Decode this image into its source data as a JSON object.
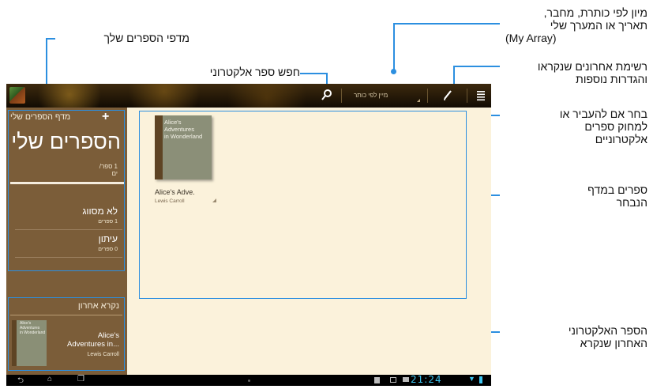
{
  "colors": {
    "accent": "#2c8fe0",
    "clock": "#3dc6f2",
    "sidebar": "#7b5d39",
    "main": "#fbf2db"
  },
  "callouts": {
    "sort_info": [
      "מיון לפי כותרת, מחבר,",
      "תאריך או המערך שלי",
      "(My Array)"
    ],
    "your_shelves": "מדפי הספרים שלך",
    "search_ebook": "חפש ספר אלקטרוני",
    "recent_list": [
      "רשימת אחרונים שנקראו",
      "והגדרות נוספות"
    ],
    "move_delete": [
      "בחר אם להעביר או",
      "למחוק ספרים",
      "אלקטרוניים"
    ],
    "books_on_shelf": [
      "ספרים במדף",
      "הנבחר"
    ],
    "last_read": [
      "הספר האלקטרוני",
      "האחרון שנקרא"
    ]
  },
  "topbar": {
    "sort_label": "מיין לפי כותר",
    "icons": [
      "app-icon",
      "search-icon",
      "edit-icon",
      "menu-icon"
    ]
  },
  "sidebar": {
    "shelf_header": "מדף הספרים שלי",
    "add_label": "+",
    "title": "הספרים שלי",
    "count_lines": [
      "1 ספר/",
      "ים"
    ],
    "categories": [
      {
        "name": "לא מסווג",
        "count": "1 ספרים"
      },
      {
        "name": "עיתון",
        "count": "0 ספרים"
      }
    ],
    "recent_header": "נקרא אחרון",
    "recent_book": {
      "cover_lines": [
        "Alice's",
        "Adventures",
        "in Wonderland"
      ],
      "title_lines": [
        "Alice's",
        "Adventures in..."
      ],
      "author": "Lewis Carroll"
    }
  },
  "main": {
    "book": {
      "cover_lines": [
        "Alice's",
        "Adventures",
        "in Wonderland"
      ],
      "title": "Alice's Adve.",
      "author": "Lewis Carroll"
    }
  },
  "statusbar": {
    "time": "21:24",
    "nav_icons": [
      "back-icon",
      "home-icon",
      "recent-apps-icon"
    ]
  }
}
